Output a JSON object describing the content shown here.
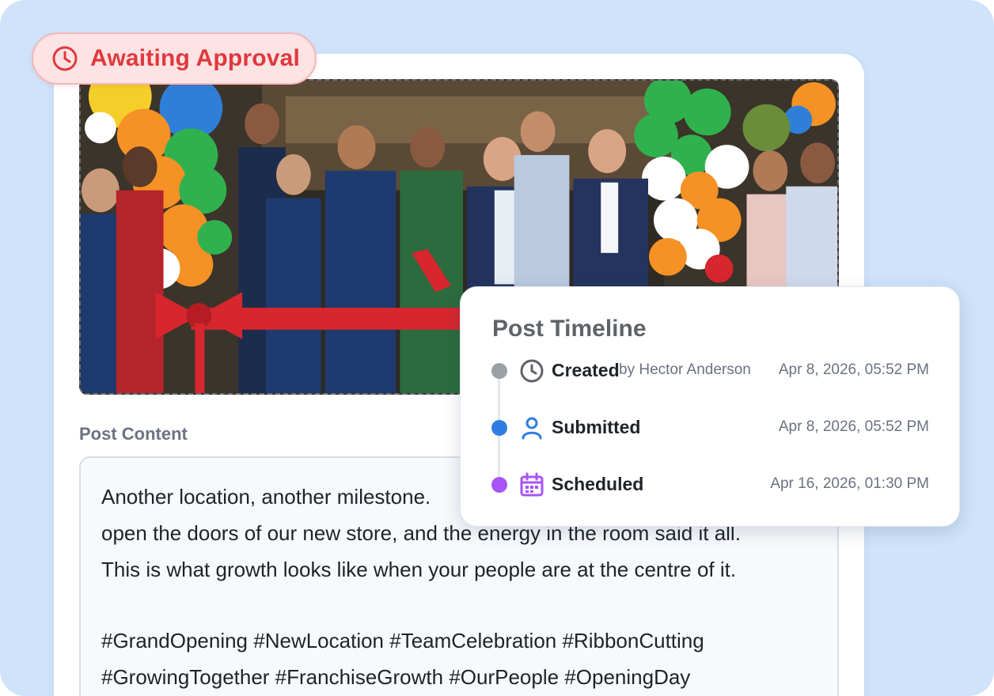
{
  "status_badge": {
    "label": "Awaiting Approval",
    "icon": "clock-icon",
    "color": "#e0383e"
  },
  "photo": {
    "subject": "ribbon-cutting-photo"
  },
  "post_content": {
    "label": "Post Content",
    "lines": [
      "Another location, another milestone.",
      "open the doors of our new store, and the energy in the room said it all.",
      "This is what growth looks like when your people are at the centre of it."
    ],
    "hashtags": [
      "#GrandOpening #NewLocation #TeamCelebration #RibbonCutting",
      "#GrowingTogether #FranchiseGrowth #OurPeople #OpeningDay"
    ]
  },
  "timeline": {
    "title": "Post Timeline",
    "events": [
      {
        "name": "Created",
        "by": "by Hector Anderson",
        "time": "Apr 8, 2026, 05:52 PM",
        "icon": "clock-icon",
        "dot_color": "#9aa0a6"
      },
      {
        "name": "Submitted",
        "by": "",
        "time": "Apr 8, 2026, 05:52 PM",
        "icon": "user-icon",
        "dot_color": "#2f7de1"
      },
      {
        "name": "Scheduled",
        "by": "",
        "time": "Apr 16, 2026, 01:30 PM",
        "icon": "calendar-icon",
        "dot_color": "#a855f7"
      }
    ]
  }
}
